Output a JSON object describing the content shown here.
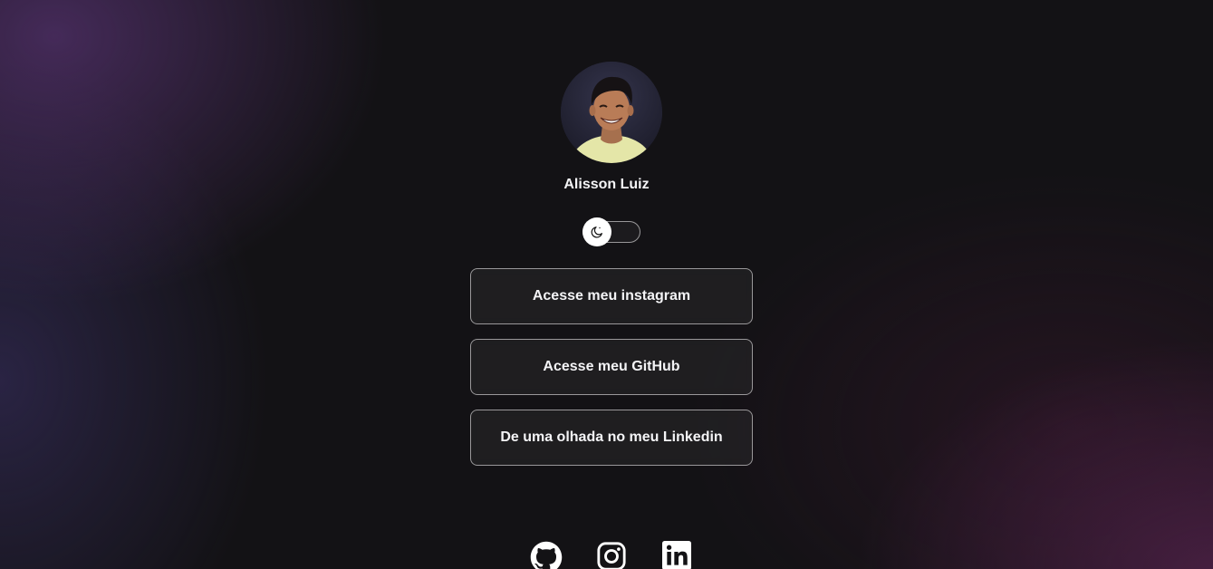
{
  "profile": {
    "name": "Alisson Luiz"
  },
  "theme_switch": {
    "icon": "moon-icon"
  },
  "links": [
    {
      "label": "Acesse meu instagram"
    },
    {
      "label": "Acesse meu GitHub"
    },
    {
      "label": "De uma olhada no meu Linkedin"
    }
  ],
  "socials": [
    {
      "icon": "github-icon"
    },
    {
      "icon": "instagram-icon"
    },
    {
      "icon": "linkedin-icon"
    }
  ],
  "colors": {
    "background": "#131215",
    "accent_purple": "#5f377d",
    "accent_magenta": "#69285f",
    "text": "#f4f4f6",
    "border": "#8a8a8e"
  }
}
